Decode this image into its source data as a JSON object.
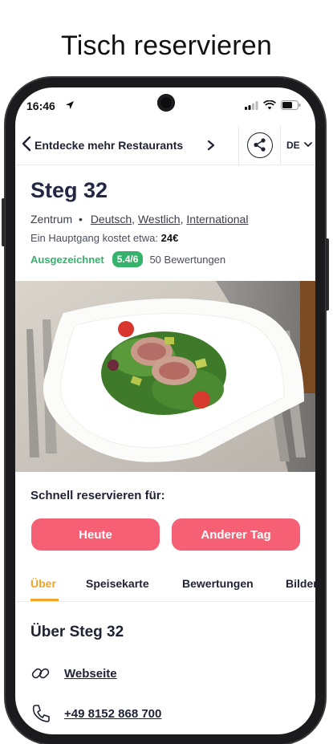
{
  "headline": "Tisch reservieren",
  "status_bar": {
    "time": "16:46"
  },
  "navbar": {
    "back_label": "Entdecke mehr Restaurants",
    "language": "DE"
  },
  "restaurant": {
    "name": "Steg 32",
    "district": "Zentrum",
    "separator": "•",
    "cuisines": [
      "Deutsch",
      "Westlich",
      "International"
    ],
    "price_label": "Ein Hauptgang kostet etwa:",
    "price_value": "24€",
    "rating_label": "Ausgezeichnet",
    "rating_value": "5.4/6",
    "review_count": "50 Bewertungen"
  },
  "quick_reserve": {
    "title": "Schnell reservieren für:",
    "today_label": "Heute",
    "other_label": "Anderer Tag"
  },
  "tabs": [
    "Über",
    "Speisekarte",
    "Bewertungen",
    "Bilder"
  ],
  "about": {
    "title": "Über Steg 32",
    "website_label": "Webseite",
    "phone": "+49 8152 868 700"
  },
  "colors": {
    "accent": "#f56074",
    "tab_active": "#f3a526",
    "rating_green": "#35b26b",
    "text_dark": "#1e2233"
  }
}
